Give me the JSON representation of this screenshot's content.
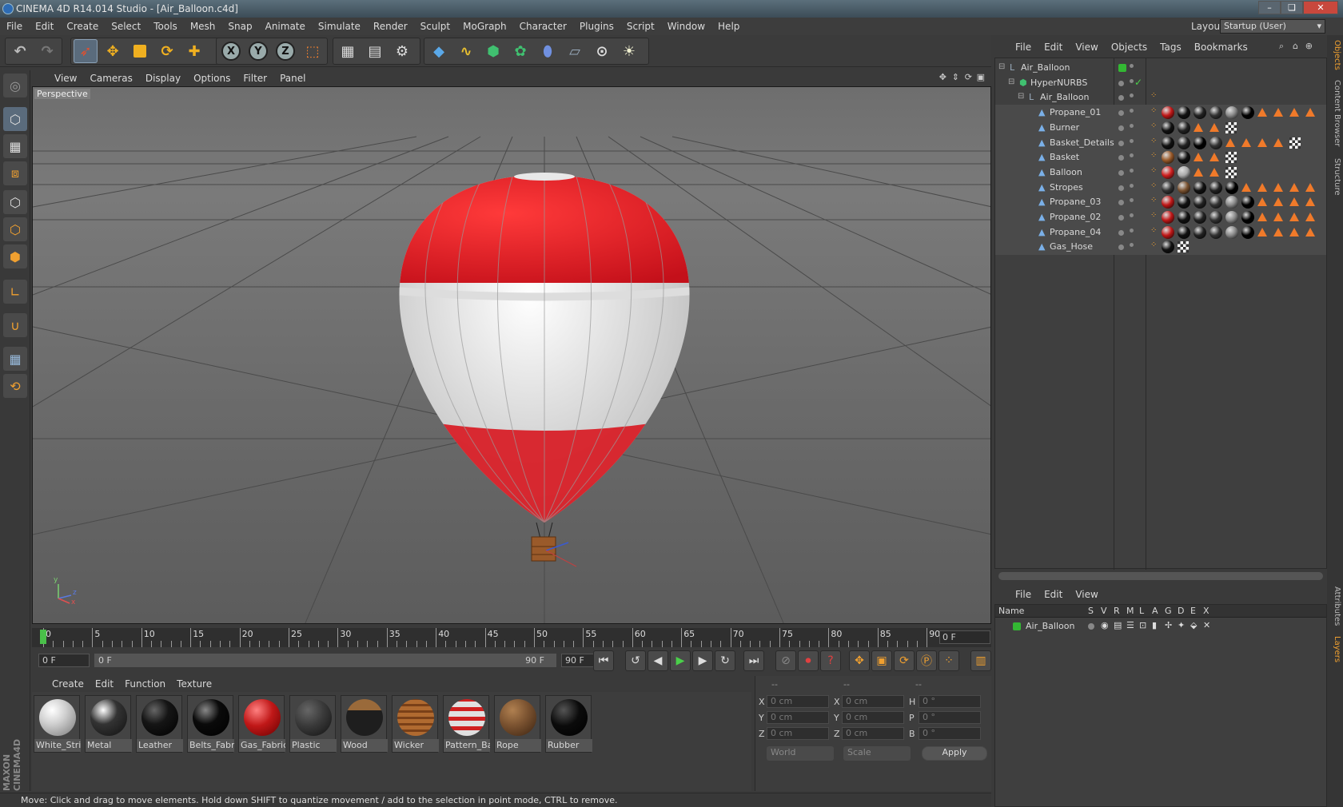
{
  "window": {
    "title": "CINEMA 4D R14.014 Studio - [Air_Balloon.c4d]",
    "minimize": "–",
    "restore": "❏",
    "close": "✕"
  },
  "menubar": {
    "items": [
      "File",
      "Edit",
      "Create",
      "Select",
      "Tools",
      "Mesh",
      "Snap",
      "Animate",
      "Simulate",
      "Render",
      "Sculpt",
      "MoGraph",
      "Character",
      "Plugins",
      "Script",
      "Window",
      "Help"
    ],
    "layout_label": "Layout:",
    "layout_value": "Startup (User)"
  },
  "toolbar": {
    "icons": [
      "undo-icon",
      "redo-icon",
      "live-selection-icon",
      "move-icon",
      "scale-icon",
      "rotate-icon",
      "add-object-icon",
      "x-axis-lock-icon",
      "y-axis-lock-icon",
      "z-axis-lock-icon",
      "coordinate-system-icon",
      "render-view-icon",
      "render-picture-viewer-icon",
      "render-settings-icon",
      "cube-primitive-icon",
      "spline-pen-icon",
      "subdivision-surface-icon",
      "cloner-icon",
      "deformer-icon",
      "floor-icon",
      "camera-icon",
      "light-icon"
    ],
    "axis_x": "X",
    "axis_y": "Y",
    "axis_z": "Z"
  },
  "viewport": {
    "menu": [
      "View",
      "Cameras",
      "Display",
      "Options",
      "Filter",
      "Panel"
    ],
    "label": "Perspective",
    "axis_labels": {
      "x": "x",
      "y": "y",
      "z": "z"
    }
  },
  "timeline": {
    "ticks": [
      "0",
      "5",
      "10",
      "15",
      "20",
      "25",
      "30",
      "35",
      "40",
      "45",
      "50",
      "55",
      "60",
      "65",
      "70",
      "75",
      "80",
      "85",
      "90"
    ],
    "current_frame": "0 F",
    "start_frame": "0 F",
    "range_start": "0 F",
    "range_end": "90 F",
    "end_frame": "90 F"
  },
  "materials": {
    "menu": [
      "Create",
      "Edit",
      "Function",
      "Texture"
    ],
    "items": [
      {
        "label": "White_Strip",
        "color": "#cfcfcf"
      },
      {
        "label": "Metal",
        "color": "#333333"
      },
      {
        "label": "Leather",
        "color": "#151515"
      },
      {
        "label": "Belts_Fabric",
        "color": "#0a0a0a"
      },
      {
        "label": "Gas_Fabric",
        "color": "#c01818"
      },
      {
        "label": "Plastic",
        "color": "#3a3a3a"
      },
      {
        "label": "Wood",
        "color": "#1e1e1e"
      },
      {
        "label": "Wicker",
        "color": "#9a5a2a"
      },
      {
        "label": "Pattern_Ba",
        "color": "#e0e0e0"
      },
      {
        "label": "Rope",
        "color": "#7a5230"
      },
      {
        "label": "Rubber",
        "color": "#0b0b0b"
      }
    ]
  },
  "coordinates": {
    "headers": [
      "--",
      "--",
      "--"
    ],
    "rows": [
      {
        "l1": "X",
        "v1": "0 cm",
        "l2": "X",
        "v2": "0 cm",
        "l3": "H",
        "v3": "0 °"
      },
      {
        "l1": "Y",
        "v1": "0 cm",
        "l2": "Y",
        "v2": "0 cm",
        "l3": "P",
        "v3": "0 °"
      },
      {
        "l1": "Z",
        "v1": "0 cm",
        "l2": "Z",
        "v2": "0 cm",
        "l3": "B",
        "v3": "0 °"
      }
    ],
    "mode": "World",
    "scale_mode": "Scale",
    "apply": "Apply"
  },
  "status": "Move: Click and drag to move elements. Hold down SHIFT to quantize movement / add to the selection in point mode, CTRL to remove.",
  "object_manager": {
    "menu": [
      "File",
      "Edit",
      "View",
      "Objects",
      "Tags",
      "Bookmarks"
    ],
    "objects": [
      {
        "name": "Air_Balloon",
        "indent": 0,
        "icon": "null-object-icon"
      },
      {
        "name": "HyperNURBS",
        "indent": 1,
        "icon": "hypernurbs-icon"
      },
      {
        "name": "Air_Balloon",
        "indent": 2,
        "icon": "null-object-icon"
      },
      {
        "name": "Propane_01",
        "indent": 3,
        "icon": "polygon-object-icon"
      },
      {
        "name": "Burner",
        "indent": 3,
        "icon": "polygon-object-icon"
      },
      {
        "name": "Basket_Details",
        "indent": 3,
        "icon": "polygon-object-icon"
      },
      {
        "name": "Basket",
        "indent": 3,
        "icon": "polygon-object-icon"
      },
      {
        "name": "Balloon",
        "indent": 3,
        "icon": "polygon-object-icon"
      },
      {
        "name": "Stropes",
        "indent": 3,
        "icon": "polygon-object-icon"
      },
      {
        "name": "Propane_03",
        "indent": 3,
        "icon": "polygon-object-icon"
      },
      {
        "name": "Propane_02",
        "indent": 3,
        "icon": "polygon-object-icon"
      },
      {
        "name": "Propane_04",
        "indent": 3,
        "icon": "polygon-object-icon"
      },
      {
        "name": "Gas_Hose",
        "indent": 3,
        "icon": "polygon-object-icon"
      }
    ]
  },
  "layer_manager": {
    "menu": [
      "File",
      "Edit",
      "View"
    ],
    "columns": [
      "Name",
      "S",
      "V",
      "R",
      "M",
      "L",
      "A",
      "G",
      "D",
      "E",
      "X"
    ],
    "layers": [
      {
        "name": "Air_Balloon",
        "color": "#33b833"
      }
    ]
  },
  "side_tabs": {
    "top": [
      "Objects",
      "Content Browser",
      "Structure"
    ],
    "bottom": [
      "Attributes",
      "Layers"
    ]
  },
  "branding": "MAXON CINEMA4D"
}
